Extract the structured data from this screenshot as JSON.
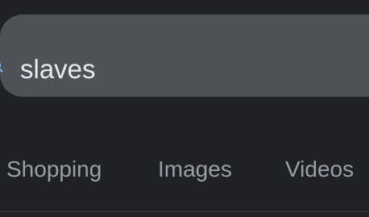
{
  "search": {
    "query": "slaves",
    "icon": "search-icon"
  },
  "tabs": [
    {
      "label": "Shopping"
    },
    {
      "label": "Images"
    },
    {
      "label": "Videos"
    }
  ],
  "colors": {
    "background": "#202124",
    "search_bar": "#4e5256",
    "query_text": "#e8eaed",
    "tab_text": "#9aa0a6",
    "icon": "#8ab4f8"
  }
}
